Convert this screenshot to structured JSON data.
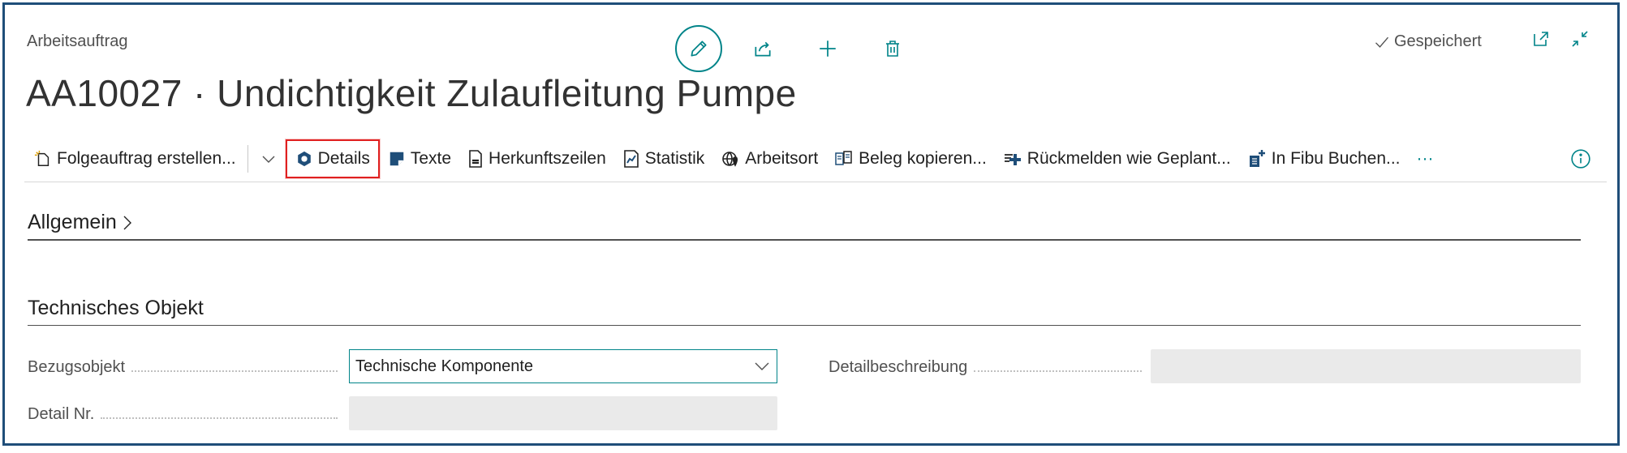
{
  "header": {
    "breadcrumb": "Arbeitsauftrag",
    "title": "AA10027 · Undichtigkeit Zulaufleitung Pumpe",
    "status": "Gespeichert"
  },
  "top_actions": {
    "edit_icon": "pencil-icon",
    "share_icon": "share-icon",
    "new_icon": "plus-icon",
    "delete_icon": "trash-icon",
    "open_new_window_icon": "open-new-window-icon",
    "collapse_icon": "collapse-icon"
  },
  "actions": {
    "folgeauftrag": "Folgeauftrag erstellen...",
    "details": "Details",
    "texte": "Texte",
    "herkunftszeilen": "Herkunftszeilen",
    "statistik": "Statistik",
    "arbeitsort": "Arbeitsort",
    "beleg": "Beleg kopieren...",
    "rueckmelden": "Rückmelden wie Geplant...",
    "fibu": "In Fibu Buchen...",
    "more": "···"
  },
  "sections": {
    "allgemein": "Allgemein",
    "technisches_objekt": "Technisches Objekt"
  },
  "fields": {
    "bezugsobjekt_label": "Bezugsobjekt",
    "bezugsobjekt_value": "Technische Komponente",
    "detail_nr_label": "Detail Nr.",
    "detail_nr_value": "",
    "detailbeschreibung_label": "Detailbeschreibung",
    "detailbeschreibung_value": ""
  },
  "colors": {
    "accent": "#008489",
    "highlight": "#e02020",
    "frame": "#1f4e79"
  }
}
